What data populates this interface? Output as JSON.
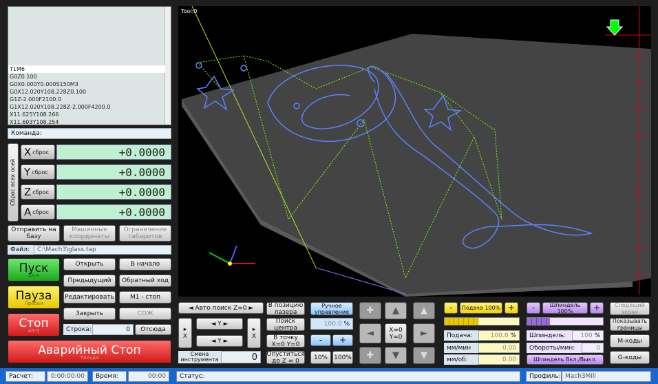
{
  "gcode": {
    "lines": [
      "T1M6",
      "G0Z0.100",
      "G0X0.000Y0.000S150M3",
      "G0X12.020Y108.228Z0.100",
      "G1Z-2.000F2100.0",
      "G1X12.020Y108.228Z-2.000F4200.0",
      "X11.625Y108.266",
      "X11.603Y108.254"
    ]
  },
  "command": {
    "label": "Команда:"
  },
  "dro": {
    "reset_all": "Сброс всех осей",
    "axes": [
      {
        "letter": "X",
        "reset": "сброс",
        "value": "+0.0000"
      },
      {
        "letter": "Y",
        "reset": "сброс",
        "value": "+0.0000"
      },
      {
        "letter": "Z",
        "reset": "сброс",
        "value": "+0.0000"
      },
      {
        "letter": "A",
        "reset": "сброс",
        "value": "+0.0000"
      }
    ]
  },
  "coords": {
    "home": "Отправить на базу",
    "machine": "Машинные координаты",
    "limits": "Ограничение габаритов"
  },
  "file": {
    "label": "Файл:",
    "path": "C:\\Mach3\\glass.tap"
  },
  "run": {
    "start": "Пуск",
    "start_sub": "Alt-R",
    "pause": "Пауза",
    "pause_sub": "Пробел",
    "stop": "Стоп",
    "stop_sub": "Alt-S",
    "estop": "Аварийный Стоп",
    "estop_sub": "Тильда"
  },
  "filebtns": {
    "open": "Открыть",
    "begin": "В начало",
    "prev": "Предыдущий",
    "reverse": "Обратный ход",
    "edit": "Редактировать",
    "m1": "M1 - стоп",
    "close": "Закрыть",
    "coolant": "СОЖ"
  },
  "line": {
    "label": "Строка:",
    "value": "0",
    "from": "Отсюда"
  },
  "viewport": {
    "tool": "Tool:0"
  },
  "jog": {
    "probe": "Авто поиск Z=0",
    "y_plus": "Y",
    "y_minus": "Y",
    "x_left": "X",
    "x_right": "X",
    "tool_change": "Смена инструмента",
    "tool_value": "0"
  },
  "laser": {
    "to_laser": "В позицию лазера",
    "center": "Поиск центра",
    "to_point": "В точку X=0 Y=0",
    "lower": "Опуститься до Z = 0",
    "manual": "Ручное управление",
    "percent": "100.0",
    "pct_sign": "%",
    "minus": "-",
    "plus": "+",
    "p10": "10%",
    "p100": "100%",
    "xy0": "X=0 Y=0"
  },
  "feed": {
    "minus": "-",
    "title": "Подача 100%",
    "plus": "+",
    "label": "Подача:",
    "value": "100.0",
    "pct": "%",
    "mm_min": "мм/мин",
    "mm_min_val": "0.00",
    "mm_rev": "мм/об:",
    "mm_rev_val": "0.00",
    "fill": 0.45
  },
  "spindle": {
    "minus": "-",
    "title": "Шпиндель 100%",
    "plus": "+",
    "label": "Шпиндель:",
    "value": "100",
    "pct": "%",
    "rpm": "Обороты/мин:",
    "rpm_val": "0",
    "toggle": "Шпиндель Вкл./Выкл.",
    "fill": 0.3
  },
  "side": {
    "next": "Следящий экран",
    "bounds": "Показывать границы",
    "mcodes": "М-коды",
    "gcodes": "G-коды"
  },
  "statusbar": {
    "calc": "Расчет:",
    "calc_val": "0:00:00:00",
    "time": "Время:",
    "time_val": "00:00",
    "status": "Статус:",
    "profile": "Профиль:",
    "profile_val": "Mach3Mill"
  }
}
